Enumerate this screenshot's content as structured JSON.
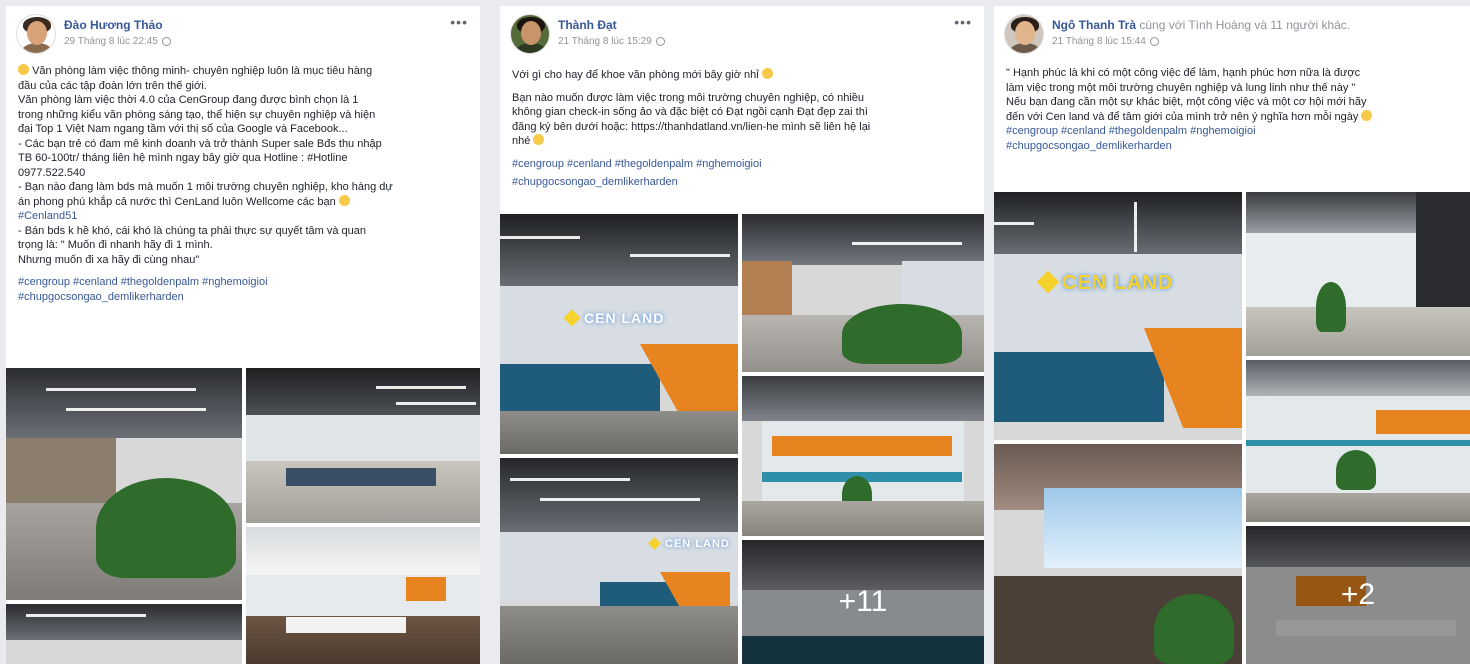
{
  "posts": [
    {
      "author": "Đào Hương Thảo",
      "with": "",
      "timestamp": "29 Tháng 8 lúc 22:45",
      "lines": [
        "Văn phòng làm việc thông minh- chuyên nghiệp luôn là mục tiêu hàng",
        "đầu của các tập đoàn lớn trên thế giới.",
        "Văn phòng làm việc thời 4.0 của CenGroup đang được bình chọn là 1",
        "trong những kiểu văn phòng sáng tạo, thể hiện sự chuyên nghiệp và hiện",
        "đại Top 1 Việt Nam ngang tầm với thị sổ của Google và Facebook...",
        "- Các bạn trẻ có đam mê kinh doanh và trở thành Super sale Bđs thu nhập",
        "TB 60-100tr/ tháng liên hệ mình ngay bây giờ qua Hotline : #Hotline",
        "0977.522.540",
        "- Bạn nào đang làm bds mà muốn 1 môi trường chuyên nghiệp, kho hàng dự",
        "án phong phú khắp cả nước thì CenLand luôn Wellcome các bạn",
        "#Cenland51",
        "- Bán bds k hề khó, cái khó là chúng ta phải thực sự quyết tâm và quan",
        "trọng là: \" Muốn đi nhanh hãy đi 1 mình.",
        "Nhưng muốn đi xa hãy đi cùng nhau\""
      ],
      "hashtags": [
        "#cengroup #cenland #thegoldenpalm #nghemoigioi",
        "#chupgocsongao_demlikerharden"
      ],
      "more_count": ""
    },
    {
      "author": "Thành Đạt",
      "with": "",
      "timestamp": "21 Tháng 8 lúc 15:29",
      "lines": [
        "Với gì cho hay để khoe văn phòng mới bây giờ nhỉ",
        "",
        "Bạn nào muốn được làm việc trong môi trường chuyên nghiệp, có nhiều",
        "không gian check-in sống ảo và đặc biệt có Đạt ngồi cạnh Đạt đẹp zai thì",
        "đăng ký bên dưới hoặc: https://thanhdatland.vn/lien-he mình sẽ liên hệ lại",
        "nhé"
      ],
      "hashtags": [
        "#cengroup #cenland #thegoldenpalm #nghemoigioi",
        "#chupgocsongao_demlikerharden"
      ],
      "more_count": "+11"
    },
    {
      "author": "Ngô Thanh Trà",
      "with": "cùng với Tình Hoàng và 11 người khác.",
      "timestamp": "21 Tháng 8 lúc 15:44",
      "lines": [
        "\" Hạnh phúc là khi có một công việc để làm, hạnh phúc hơn nữa là được",
        "làm việc trong một môi trường chuyên nghiệp và lung linh như thế này \"",
        "Nếu bạn đang cần một sự khác biệt, một công việc và một cơ hội mới hãy",
        "đến với Cen land và để tâm giới của mình trở nên ý nghĩa hơn mỗi ngày"
      ],
      "hashtags": [
        "#cengroup #cenland #thegoldenpalm #nghemoigioi",
        "#chupgocsongao_demlikerharden"
      ],
      "more_count": "+2"
    }
  ],
  "brand_logo": "CEN LAND",
  "more_menu": "•••"
}
